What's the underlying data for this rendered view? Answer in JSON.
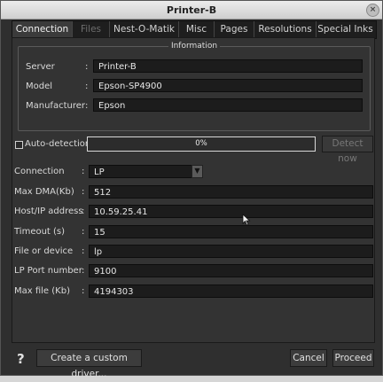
{
  "window": {
    "title": "Printer-B",
    "close_glyph": "×"
  },
  "tabs": [
    {
      "label": "Connection",
      "active": true,
      "disabled": false
    },
    {
      "label": "Files",
      "active": false,
      "disabled": true
    },
    {
      "label": "Nest-O-Matik",
      "active": false,
      "disabled": false
    },
    {
      "label": "Misc",
      "active": false,
      "disabled": false
    },
    {
      "label": "Pages",
      "active": false,
      "disabled": false
    },
    {
      "label": "Resolutions",
      "active": false,
      "disabled": false
    },
    {
      "label": "Special Inks",
      "active": false,
      "disabled": false
    }
  ],
  "information": {
    "title": "Information",
    "server": {
      "label": "Server",
      "value": "Printer-B"
    },
    "model": {
      "label": "Model",
      "value": "Epson-SP4900"
    },
    "manufacturer": {
      "label": "Manufacturer",
      "value": "Epson"
    }
  },
  "colon": ":",
  "detection": {
    "checkbox_label": "Auto-detection",
    "checked": false,
    "progress_text": "0%",
    "progress_value": 0,
    "detect_button": "Detect now"
  },
  "settings": {
    "connection": {
      "label": "Connection",
      "value": "LP",
      "arrow": "▼"
    },
    "max_dma": {
      "label": "Max DMA(Kb)",
      "value": "512"
    },
    "host": {
      "label": "Host/IP address",
      "value": "10.59.25.41"
    },
    "timeout": {
      "label": "Timeout (s)",
      "value": "15"
    },
    "file_device": {
      "label": "File or device",
      "value": "lp"
    },
    "lp_port": {
      "label": "LP Port number",
      "value": "9100"
    },
    "max_file": {
      "label": "Max file (Kb)",
      "value": "4194303"
    }
  },
  "footer": {
    "help": "?",
    "custom_driver": "Create a custom driver...",
    "cancel": "Cancel",
    "proceed": "Proceed"
  }
}
